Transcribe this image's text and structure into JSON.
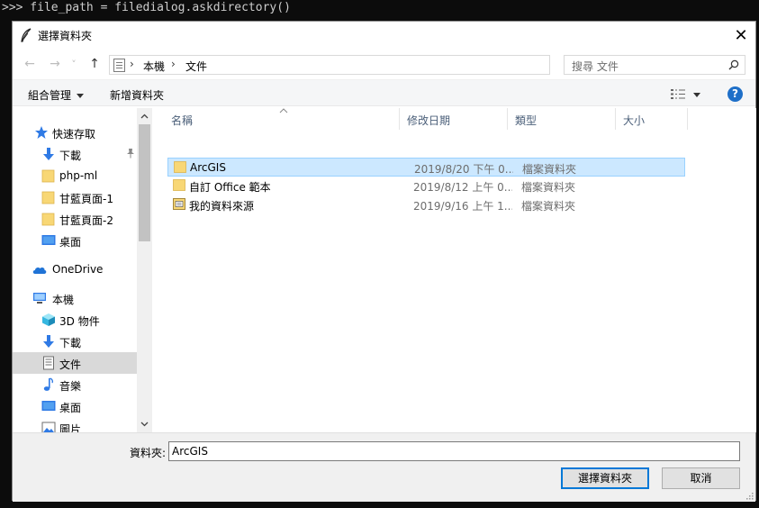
{
  "console": {
    "line": ">>> file_path = filedialog.askdirectory()"
  },
  "dialog": {
    "title": "選擇資料夾",
    "close_glyph": "✕"
  },
  "navbar": {
    "back_glyph": "←",
    "forward_glyph": "→",
    "recent_glyph": "˅",
    "up_glyph": "↑",
    "breadcrumbs": [
      "本機",
      "文件"
    ],
    "crumb_separator": "›",
    "dropdown_glyph": "⌵",
    "refresh_glyph": "↻",
    "search_placeholder": "搜尋 文件"
  },
  "toolbar": {
    "organize_label": "組合管理",
    "new_folder_label": "新增資料夾",
    "help_label": "?"
  },
  "nav_pane": {
    "items": [
      {
        "label": "快速存取",
        "icon": "star-icon"
      },
      {
        "label": "下載",
        "icon": "download-icon",
        "pinned": true
      },
      {
        "label": "php-ml",
        "icon": "folder-icon"
      },
      {
        "label": "甘藍頁面-1",
        "icon": "folder-icon"
      },
      {
        "label": "甘藍頁面-2",
        "icon": "folder-icon"
      },
      {
        "label": "桌面",
        "icon": "desktop-icon"
      },
      {
        "label": "OneDrive",
        "icon": "cloud-icon"
      },
      {
        "label": "本機",
        "icon": "computer-icon"
      },
      {
        "label": "3D 物件",
        "icon": "cube-icon"
      },
      {
        "label": "下載",
        "icon": "download-icon"
      },
      {
        "label": "文件",
        "icon": "document-icon",
        "selected": true
      },
      {
        "label": "音樂",
        "icon": "music-icon"
      },
      {
        "label": "桌面",
        "icon": "desktop-icon"
      },
      {
        "label": "圖片",
        "icon": "picture-icon"
      }
    ],
    "pin_glyph": "📌",
    "scroll_up_glyph": "⌃",
    "scroll_down_glyph": "⌄"
  },
  "files": {
    "columns": [
      "名稱",
      "修改日期",
      "類型",
      "大小"
    ],
    "sort_glyph": "⌃",
    "rows": [
      {
        "name": "ArcGIS",
        "date": "2019/8/20 下午 0...",
        "type": "檔案資料夾",
        "icon": "folder-icon",
        "selected": true
      },
      {
        "name": "自訂 Office 範本",
        "date": "2019/8/12 上午 0...",
        "type": "檔案資料夾",
        "icon": "folder-icon"
      },
      {
        "name": "我的資料來源",
        "date": "2019/9/16 上午 1...",
        "type": "檔案資料夾",
        "icon": "data-source-folder-icon"
      }
    ]
  },
  "footer": {
    "folder_label": "資料夾:",
    "folder_value": "ArcGIS",
    "select_button": "選擇資料夾",
    "cancel_button": "取消"
  },
  "colors": {
    "accent": "#0078d7",
    "selection_bg": "#cce8ff",
    "selection_border": "#99d1ff",
    "folder_yellow": "#f8d775",
    "help_blue": "#1e6fc8"
  }
}
